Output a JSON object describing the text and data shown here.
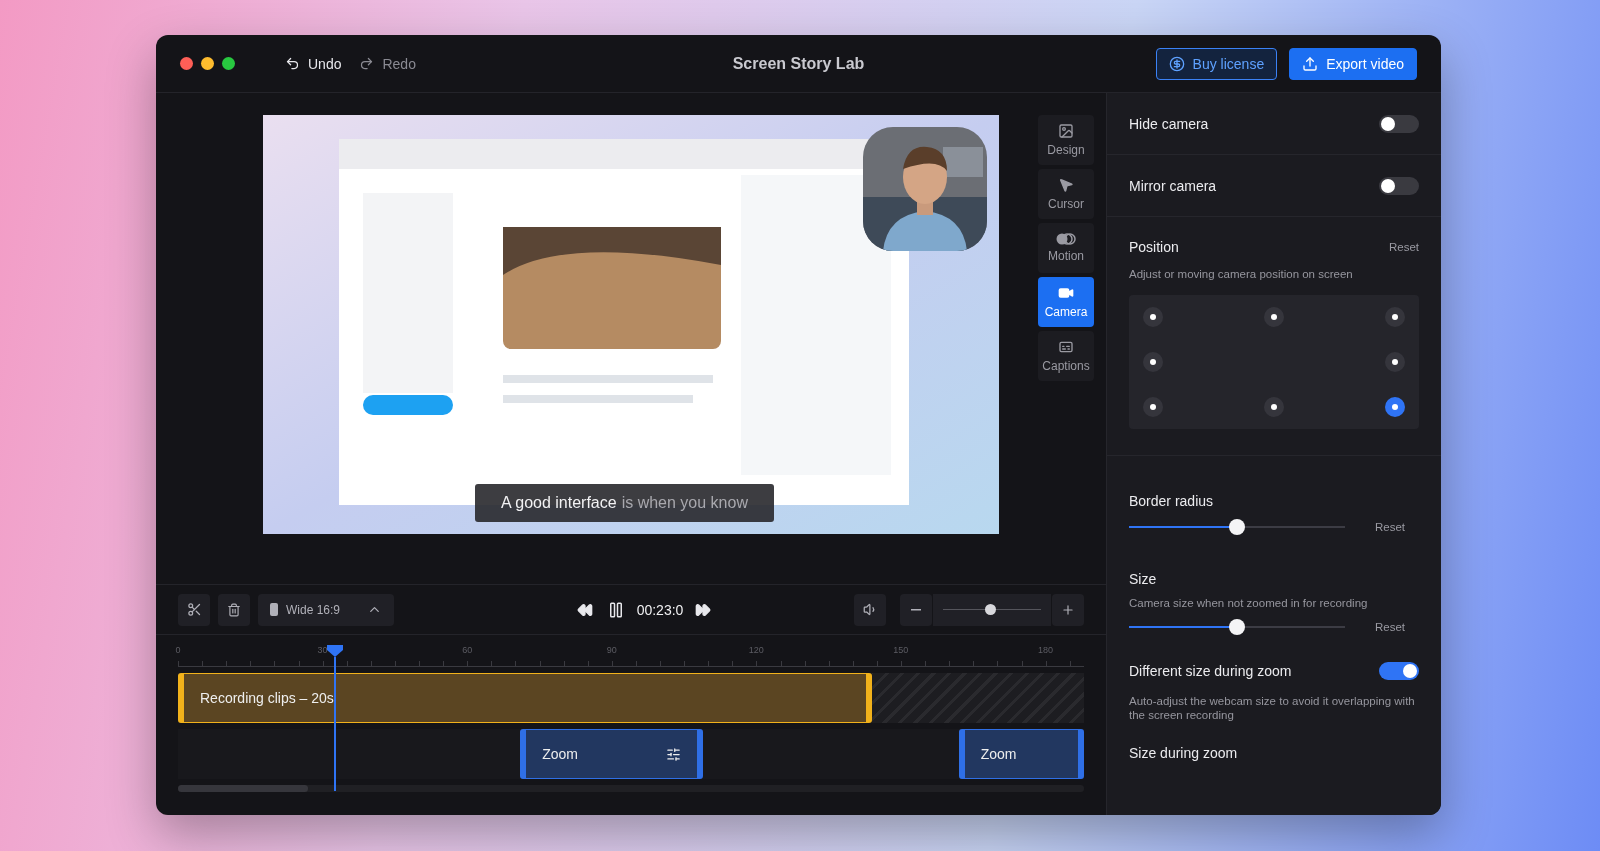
{
  "window": {
    "title": "Screen Story Lab"
  },
  "history": [
    {
      "label": "Undo",
      "disabled": false
    },
    {
      "label": "Redo",
      "disabled": true
    }
  ],
  "actions": [
    {
      "label": "Buy license",
      "kind": "outline"
    },
    {
      "label": "Export video",
      "kind": "primary"
    }
  ],
  "preview": {
    "caption": {
      "spoken": "A good interface",
      "upcoming": "is when you know"
    }
  },
  "side_tabs": [
    {
      "label": "Design",
      "selected": false
    },
    {
      "label": "Cursor",
      "selected": false
    },
    {
      "label": "Motion",
      "selected": false
    },
    {
      "label": "Camera",
      "selected": true
    },
    {
      "label": "Captions",
      "selected": false
    }
  ],
  "panel": [
    {
      "kind": "toggle",
      "label": "Hide camera",
      "on": false
    },
    {
      "kind": "toggle",
      "label": "Mirror camera",
      "on": false
    },
    {
      "kind": "position",
      "label": "Position",
      "reset": "Reset",
      "description": "Adjust or moving camera position on screen",
      "spots": [
        {
          "selected": false
        },
        {
          "selected": false
        },
        {
          "selected": false
        },
        {
          "selected": false
        },
        {
          "selected": false
        },
        {
          "selected": false
        },
        {
          "selected": false
        },
        {
          "selected": true
        }
      ]
    },
    {
      "kind": "slider",
      "label": "Border radius",
      "level": 0.5,
      "reset": "Reset"
    },
    {
      "kind": "slider",
      "label": "Size",
      "description": "Camera size when not zoomed in for recording",
      "level": 0.5,
      "reset": "Reset"
    },
    {
      "kind": "toggle",
      "label": "Different size during zoom",
      "on": true,
      "description": "Auto-adjust the webcam size to avoid it overlapping with the screen recording"
    },
    {
      "kind": "heading",
      "label": "Size during zoom"
    }
  ],
  "toolbar": {
    "aspect": "Wide 16:9",
    "time": "00:23:0",
    "zoom": {
      "level": 0.48
    }
  },
  "timeline": {
    "ticks": [
      "0",
      "30",
      "60",
      "90",
      "120",
      "150",
      "180"
    ],
    "clips": [
      {
        "kind": "recording",
        "label": "Recording clips – 20s"
      },
      {
        "kind": "zoom",
        "label": "Zoom",
        "settings": true
      },
      {
        "kind": "zoom",
        "label": "Zoom",
        "settings": false
      }
    ]
  }
}
